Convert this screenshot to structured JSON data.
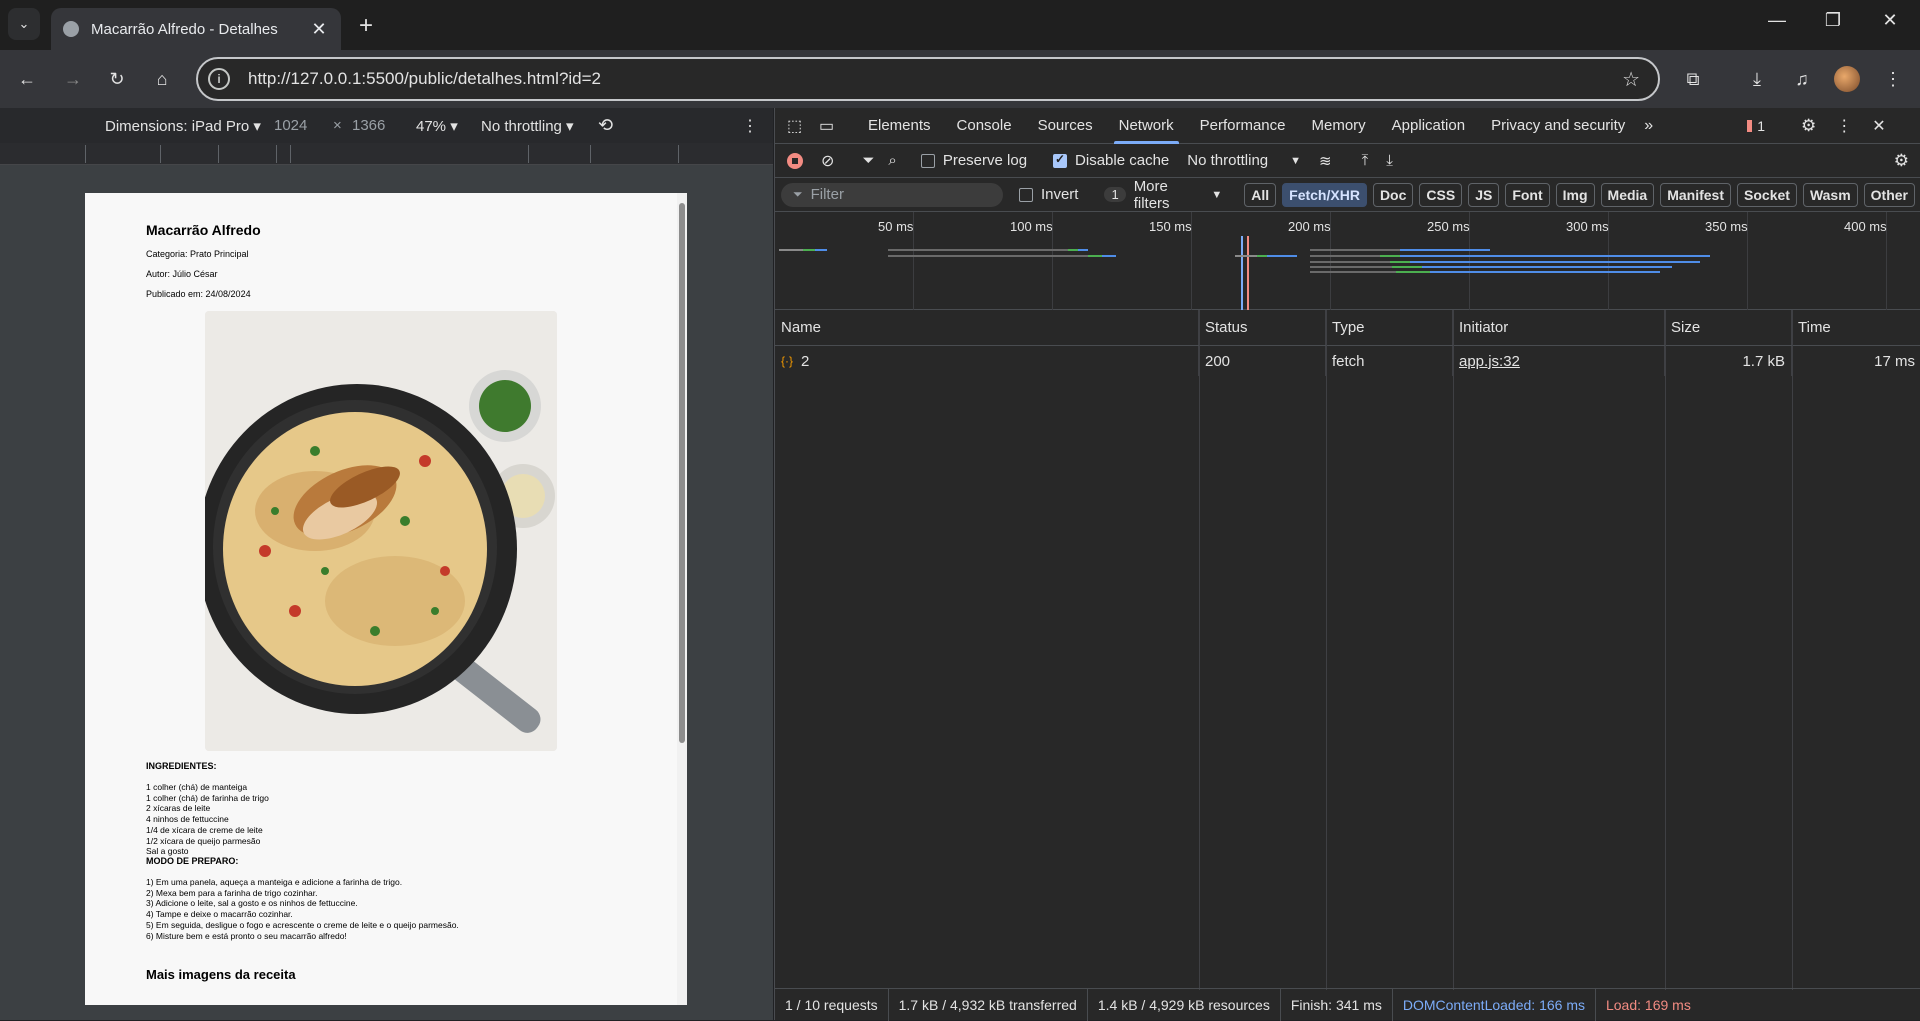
{
  "browser": {
    "tab_title": "Macarrão Alfredo - Detalhes",
    "url": "http://127.0.0.1:5500/public/detalhes.html?id=2"
  },
  "device_toolbar": {
    "dimensions": "Dimensions: iPad Pro",
    "width": "1024",
    "times": "×",
    "height": "1366",
    "zoom": "47%",
    "throttling": "No throttling"
  },
  "recipe": {
    "title": "Macarrão Alfredo",
    "category": "Categoria: Prato Principal",
    "author": "Autor: Júlio César",
    "published": "Publicado em: 24/08/2024",
    "ingredients_heading": "INGREDIENTES:",
    "ingredients": [
      "1 colher (chá) de manteiga",
      "1 colher (chá) de farinha de trigo",
      "2 xícaras de leite",
      "4 ninhos de fettuccine",
      "1/4 de xícara de creme de leite",
      "1/2 xícara de queijo parmesão",
      "Sal a gosto"
    ],
    "method_heading": "MODO DE PREPARO:",
    "steps": [
      "1) Em uma panela, aqueça a manteiga e adicione a farinha de trigo.",
      "2) Mexa bem para a farinha de trigo cozinhar.",
      "3) Adicione o leite, sal a gosto e os ninhos de fettuccine.",
      "4) Tampe e deixe o macarrão cozinhar.",
      "5) Em seguida, desligue o fogo e acrescente o creme de leite e o queijo parmesão.",
      "6) Misture bem e está pronto o seu macarrão alfredo!"
    ],
    "more_images": "Mais imagens da receita"
  },
  "devtools": {
    "tabs": [
      "Elements",
      "Console",
      "Sources",
      "Network",
      "Performance",
      "Memory",
      "Application",
      "Privacy and security"
    ],
    "active_tab": "Network",
    "issues_count": "1",
    "preserve_log": "Preserve log",
    "disable_cache": "Disable cache",
    "throttling": "No throttling",
    "filter_placeholder": "Filter",
    "invert": "Invert",
    "more_filters_count": "1",
    "more_filters": "More filters",
    "type_filters": [
      "All",
      "Fetch/XHR",
      "Doc",
      "CSS",
      "JS",
      "Font",
      "Img",
      "Media",
      "Manifest",
      "Socket",
      "Wasm",
      "Other"
    ],
    "active_type": "Fetch/XHR",
    "timeline_labels": [
      "50 ms",
      "100 ms",
      "150 ms",
      "200 ms",
      "250 ms",
      "300 ms",
      "350 ms",
      "400 ms"
    ],
    "columns": [
      "Name",
      "Status",
      "Type",
      "Initiator",
      "Size",
      "Time"
    ],
    "rows": [
      {
        "name": "2",
        "status": "200",
        "type": "fetch",
        "initiator": "app.js:32",
        "size": "1.7 kB",
        "time": "17 ms"
      }
    ],
    "status": {
      "requests": "1 / 10 requests",
      "transferred": "1.7 kB / 4,932 kB transferred",
      "resources": "1.4 kB / 4,929 kB resources",
      "finish": "Finish: 341 ms",
      "dcl": "DOMContentLoaded: 166 ms",
      "load": "Load: 169 ms"
    },
    "colors": {
      "accent": "#7cacf8",
      "dcl": "#7cacf8",
      "load": "#f28b82"
    }
  }
}
